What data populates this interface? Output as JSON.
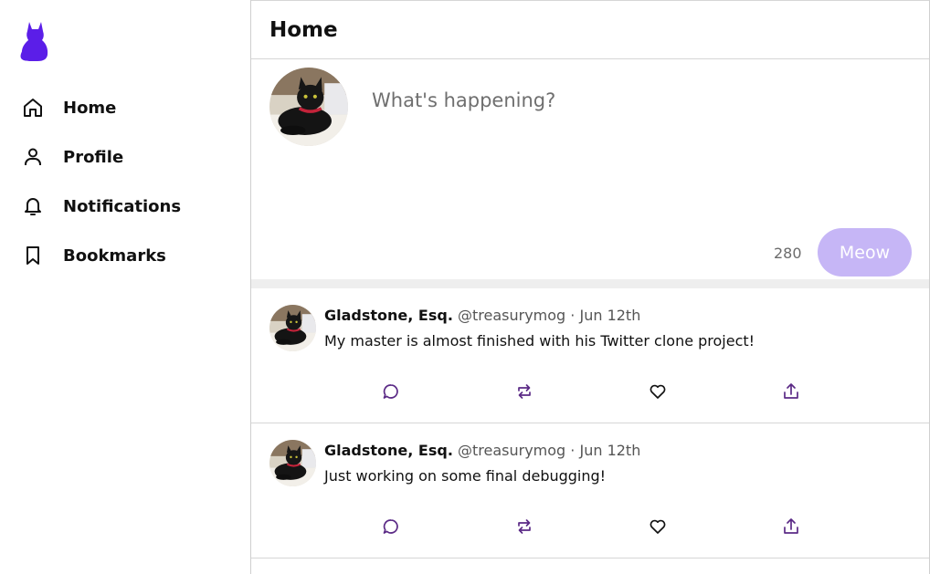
{
  "sidebar": {
    "logo_icon": "cat-logo-icon",
    "brand_color": "#5b1ee8",
    "items": [
      {
        "label": "Home",
        "icon": "home-icon"
      },
      {
        "label": "Profile",
        "icon": "person-icon"
      },
      {
        "label": "Notifications",
        "icon": "bell-icon"
      },
      {
        "label": "Bookmarks",
        "icon": "bookmark-icon"
      }
    ]
  },
  "header": {
    "title": "Home"
  },
  "composer": {
    "placeholder": "What's happening?",
    "char_count": "280",
    "submit_label": "Meow",
    "submit_color": "#c6b6f6"
  },
  "tweets": [
    {
      "name": "Gladstone, Esq.",
      "handle": "@treasurymog",
      "separator": "·",
      "date": "Jun 12th",
      "text": "My master is almost finished with his Twitter clone project!"
    },
    {
      "name": "Gladstone, Esq.",
      "handle": "@treasurymog",
      "separator": "·",
      "date": "Jun 12th",
      "text": "Just working on some final debugging!"
    }
  ],
  "action_icons": [
    "reply-icon",
    "retweet-icon",
    "like-icon",
    "share-icon"
  ],
  "action_color": "#5b2a86"
}
